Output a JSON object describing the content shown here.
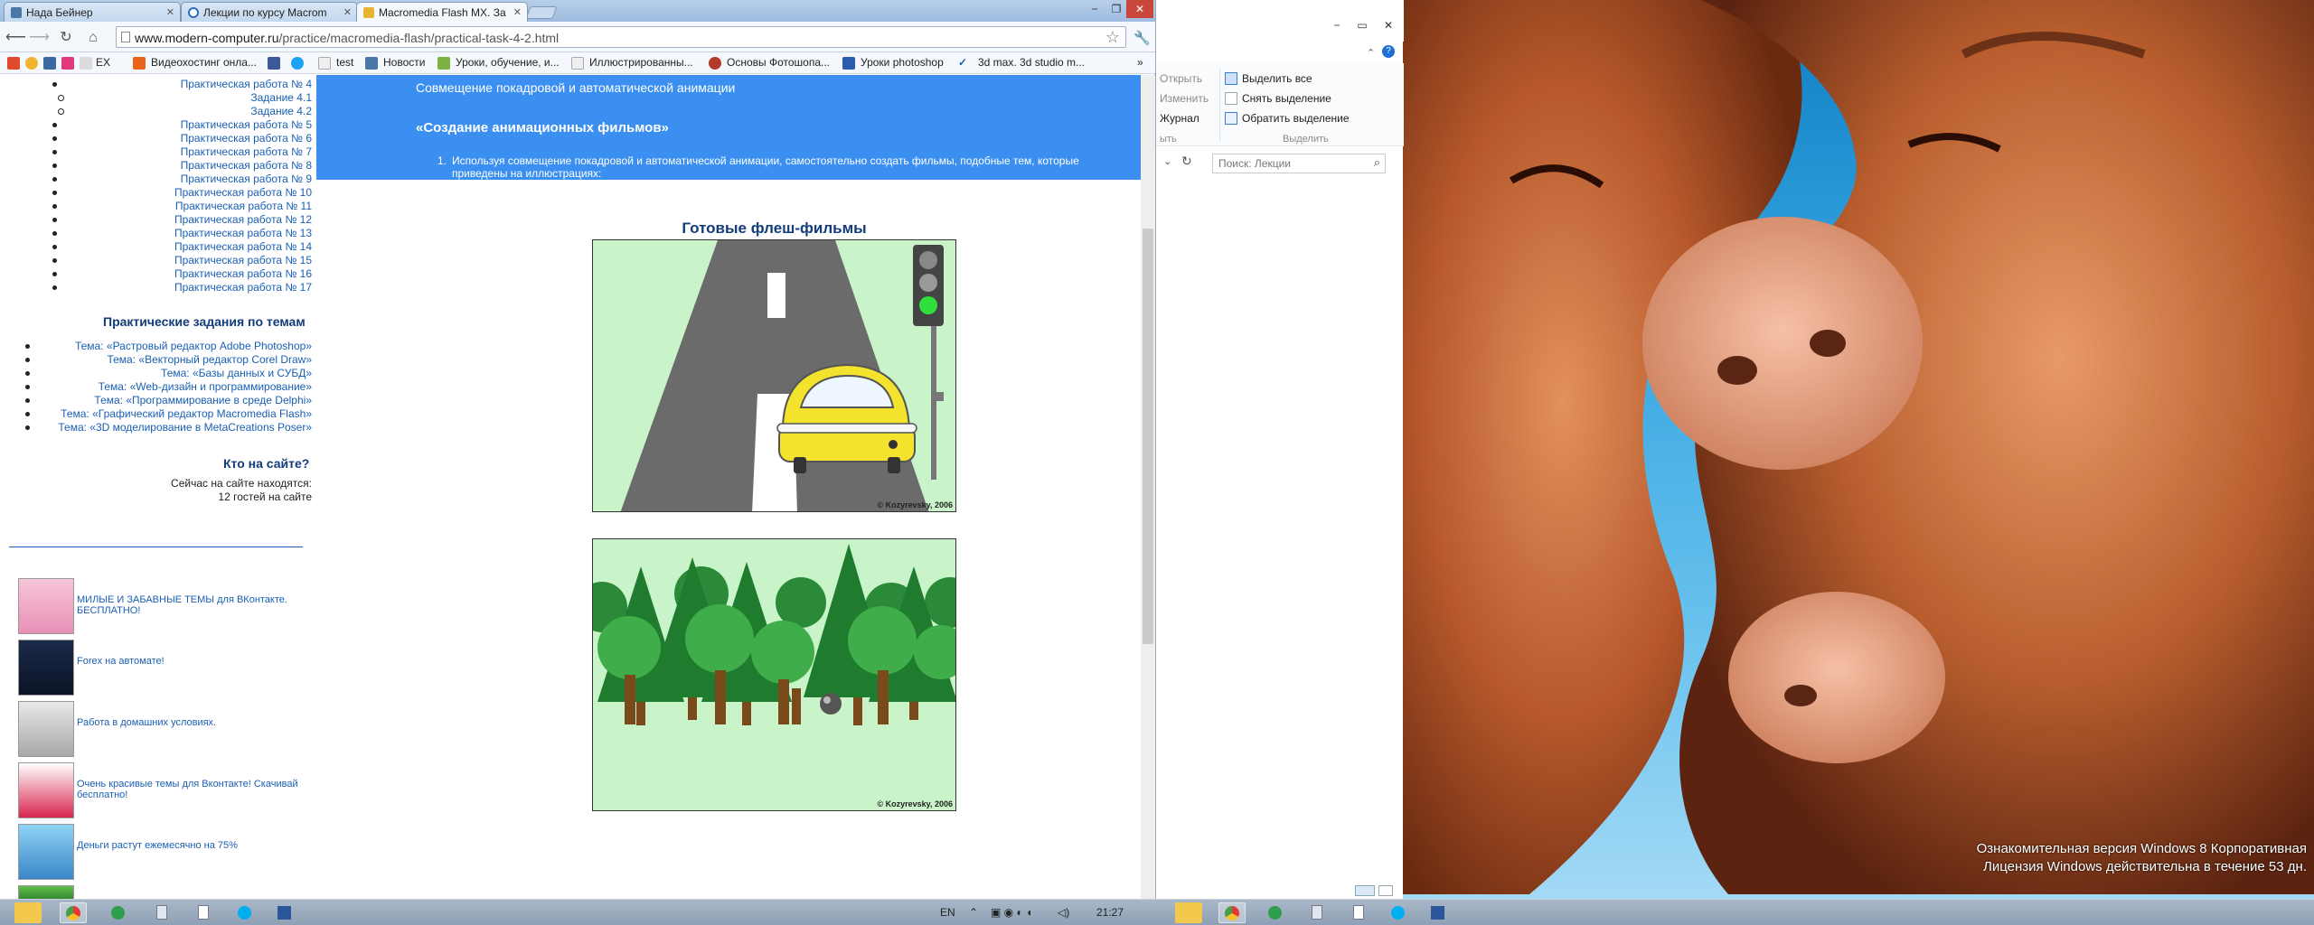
{
  "watermark": {
    "line1": "Ознакомительная версия Windows 8 Корпоративная",
    "line2": "Лицензия Windows действительна в течение 53 дн."
  },
  "browser": {
    "tabs": [
      {
        "title": "Нада Бейнер"
      },
      {
        "title": "Лекции по курсу Macrom"
      },
      {
        "title": "Macromedia Flash MX. За"
      }
    ],
    "url_host": "www.modern-computer.ru",
    "url_path": "/practice/macromedia-flash/practical-task-4-2.html",
    "bookmarks": [
      "ЕХ",
      "Видеохостинг онла...",
      "test",
      "Новости",
      "Уроки, обучение, и...",
      "Иллюстрированны...",
      "Основы Фотошопа...",
      "Уроки photoshop",
      "3d max. 3d studio m..."
    ],
    "bookmarks_more": "»"
  },
  "left": {
    "work_links": [
      "Практическая работа № 4",
      "Задание 4.1",
      "Задание 4.2",
      "Практическая работа № 5",
      "Практическая работа № 6",
      "Практическая работа № 7",
      "Практическая работа № 8",
      "Практическая работа № 9",
      "Практическая работа № 10",
      "Практическая работа № 11",
      "Практическая работа № 12",
      "Практическая работа № 13",
      "Практическая работа № 14",
      "Практическая работа № 15",
      "Практическая работа № 16",
      "Практическая работа № 17"
    ],
    "topics_heading": "Практические задания по темам",
    "topics": [
      "Тема: «Растровый редактор Adobe Photoshop»",
      "Тема: «Векторный редактор Corel Draw»",
      "Тема: «Базы данных и СУБД»",
      "Тема: «Web-дизайн и программирование»",
      "Тема: «Программирование в среде Delphi»",
      "Тема: «Графический редактор Macromedia Flash»",
      "Тема: «3D моделирование в MetaCreations Poser»"
    ],
    "who_heading": "Кто на сайте?",
    "who_line1": "Сейчас на сайте находятся:",
    "who_line2": "12 гостей на сайте",
    "ads": [
      "МИЛЫЕ И ЗАБАВНЫЕ ТЕМЫ для ВКонтакте. БЕСПЛАТНО!",
      "Forex на автомате!",
      "Работа в домашних условиях.",
      "Очень красивые темы для Вконтакте! Скачивай бесплатно!",
      "Деньги растут ежемесячно на 75%"
    ]
  },
  "main": {
    "section_title": "Совмещение покадровой и автоматической анимации",
    "task_title": "«Создание анимационных фильмов»",
    "task_number": "1.",
    "task_text": "Используя совмещение покадровой и автоматической анимации, самостоятельно создать фильмы, подобные тем, которые приведены на иллюстрациях:",
    "films_title": "Готовые флеш-фильмы",
    "copyright": "© Kozyrevsky, 2006"
  },
  "explorer": {
    "open": "Открыть",
    "edit": "Изменить",
    "journal": "Журнал",
    "group_open": "ыть",
    "select_all": "Выделить все",
    "deselect": "Снять выделение",
    "invert": "Обратить выделение",
    "group_select": "Выделить",
    "search_placeholder": "Поиск: Лекции"
  },
  "taskbar": {
    "lang": "EN",
    "time": "21:27"
  }
}
